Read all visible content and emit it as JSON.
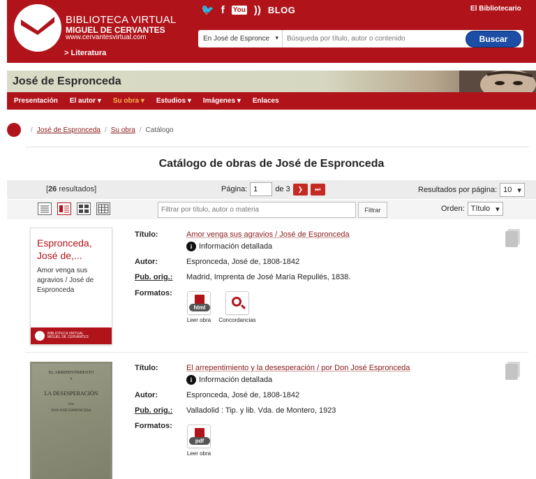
{
  "header": {
    "brand_line1": "BIBLIOTECA VIRTUAL",
    "brand_line2": "MIGUEL DE CERVANTES",
    "brand_line3": "www.cervantesvirtual.com",
    "section_link": "> Literatura",
    "social": {
      "twitter": "🐦",
      "facebook": "f",
      "youtube": "You",
      "rss": "))",
      "blog": "BLOG"
    },
    "user_link": "El Bibliotecario",
    "search": {
      "scope": "En José de Espronce",
      "placeholder": "Búsqueda por título, autor o contenido",
      "button": "Buscar"
    }
  },
  "author": {
    "name": "José de Espronceda"
  },
  "nav": [
    "Presentación",
    "El autor ▾",
    "Su obra ▾",
    "Estudios ▾",
    "Imágenes ▾",
    "Enlaces"
  ],
  "breadcrumb": {
    "items": [
      "José de Espronceda",
      "Su obra"
    ],
    "current": "Catálogo",
    "sep": "/"
  },
  "page_title": "Catálogo de obras de José de Espronceda",
  "results": {
    "count_prefix": "[",
    "count": "26",
    "count_suffix": " resultados]",
    "page_label": "Página:",
    "page_value": "1",
    "page_of": "de 3",
    "next": "❯",
    "last": "⏭",
    "per_page_label": "Resultados por página:",
    "per_page_value": "10",
    "filter_placeholder": "Filtrar por título, autor o materia",
    "filter_button": "Filtrar",
    "order_label": "Orden:",
    "order_value": "Título"
  },
  "labels": {
    "titulo": "Título:",
    "autor": "Autor:",
    "pub": "Pub. orig.:",
    "formatos": "Formatos:",
    "info": "Información detallada"
  },
  "records": [
    {
      "cover_title_l1": "Espronceda,",
      "cover_title_l2": "José de,...",
      "cover_sub": "Amor venga sus agravios / José de Espronceda",
      "titulo": "Amor venga sus agravios / José de Espronceda",
      "autor": "Espronceda, José de, 1808-1842",
      "pub": "Madrid, Imprenta de José María Repullés, 1838.",
      "formats": [
        {
          "tag": "html",
          "label": "Leer obra"
        },
        {
          "tag": "",
          "label": "Concordancias"
        }
      ]
    },
    {
      "scan_l1": "EL ARREPENTIMIENTO",
      "scan_l2": "Y",
      "scan_l3": "LA DESESPERACIÓN",
      "scan_l4": "POR",
      "scan_l5": "DON JOSÉ ESPRONCEDA",
      "titulo": "El arrepentimiento y la desesperación / por Don José Espronceda",
      "autor": "Espronceda, José de, 1808-1842",
      "pub": "Valladolid : Tip. y lib. Vda. de Montero, 1923",
      "formats": [
        {
          "tag": "pdf",
          "label": "Leer obra"
        }
      ]
    }
  ]
}
